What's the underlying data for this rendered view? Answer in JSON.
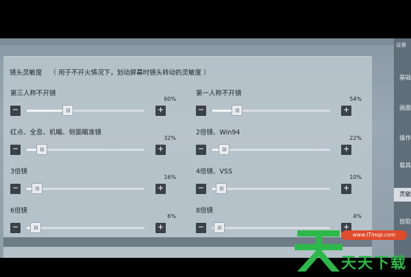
{
  "panel": {
    "title": "镜头灵敏度",
    "subtitle": "（ 用于不开火情况下，划动屏幕时镜头转动的灵敏度 ）"
  },
  "sliders": [
    {
      "label": "第三人称不开镜",
      "value_text": "60%",
      "level": 0.3,
      "col": 0,
      "row": 0
    },
    {
      "label": "第一人称不开镜",
      "value_text": "54%",
      "level": 0.16,
      "col": 1,
      "row": 0
    },
    {
      "label": "红点、全息、机瞄、侧面瞄准镜",
      "value_text": "32%",
      "level": 0.08,
      "col": 0,
      "row": 1
    },
    {
      "label": "2倍镜、Win94",
      "value_text": "22%",
      "level": 0.05,
      "col": 1,
      "row": 1
    },
    {
      "label": "3倍镜",
      "value_text": "16%",
      "level": 0.04,
      "col": 0,
      "row": 2
    },
    {
      "label": "4倍镜、VSS",
      "value_text": "10%",
      "level": 0.03,
      "col": 1,
      "row": 2
    },
    {
      "label": "6倍镜",
      "value_text": "6%",
      "level": 0.03,
      "col": 0,
      "row": 3
    },
    {
      "label": "8倍镜",
      "value_text": "4%",
      "level": 0.01,
      "col": 1,
      "row": 3
    }
  ],
  "buttons": {
    "minus": "−",
    "plus": "+"
  },
  "sidebar": {
    "settings": "设置",
    "items": [
      {
        "label": "基础",
        "active": false
      },
      {
        "label": "画面",
        "active": false
      },
      {
        "label": "操作",
        "active": false
      },
      {
        "label": "载具",
        "active": false
      },
      {
        "label": "灵敏度",
        "active": true
      },
      {
        "label": "拾取",
        "active": false
      }
    ]
  },
  "watermark": {
    "url": "www.ITmop.com",
    "name": "天天下载"
  },
  "colors": {
    "logo_green": "#2db84a",
    "logo_red": "#e14b2b"
  }
}
